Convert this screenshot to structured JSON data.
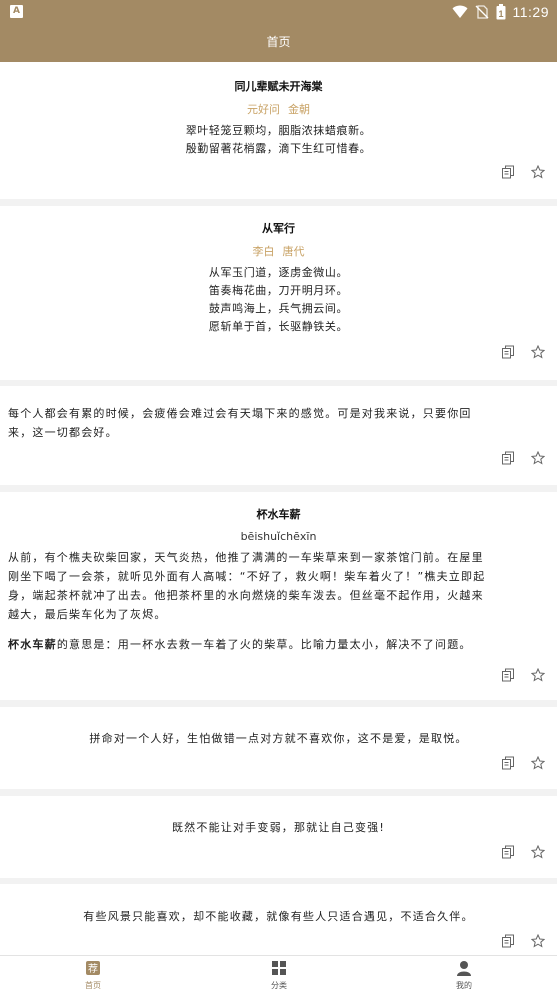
{
  "status": {
    "app_badge": "A",
    "time": "11:29",
    "battery_text": "1"
  },
  "header": {
    "title": "首页"
  },
  "cards": {
    "c1": {
      "title": "同儿辈赋未开海棠",
      "author": "元好问",
      "dynasty": "金朝",
      "lines": [
        "翠叶轻笼豆颗均，胭脂浓抹蜡痕新。",
        "殷勤留著花梢露，滴下生红可惜春。"
      ]
    },
    "c2": {
      "title": "从军行",
      "author": "李白",
      "dynasty": "唐代",
      "lines": [
        "从军玉门道，逐虏金微山。",
        "笛奏梅花曲，刀开明月环。",
        "鼓声鸣海上，兵气拥云间。",
        "愿斩单于首，长驱静铁关。"
      ]
    },
    "c3": {
      "line1": "每个人都会有累的时候，会疲倦会难过会有天塌下来的感觉。可是对我来说，只要你回",
      "line2": "来，这一切都会好。"
    },
    "c4": {
      "title": "杯水车薪",
      "pinyin": "bēishuǐchēxīn",
      "story": [
        "从前，有个樵夫砍柴回家，天气炎热，他推了满满的一车柴草来到一家茶馆门前。在屋里",
        "刚坐下喝了一会茶，就听见外面有人高喊：“不好了，救火啊！柴车着火了！”樵夫立即起",
        "身，端起茶杯就冲了出去。他把茶杯里的水向燃烧的柴车泼去。但丝毫不起作用，火越来",
        "越大，最后柴车化为了灰烬。"
      ],
      "meaning_term": "杯水车薪",
      "meaning_text": "的意思是：用一杯水去救一车着了火的柴草。比喻力量太小，解决不了问题。"
    },
    "c5": {
      "text": "拼命对一个人好，生怕做错一点对方就不喜欢你，这不是爱，是取悦。"
    },
    "c6": {
      "text": "既然不能让对手变弱，那就让自己变强!"
    },
    "c7": {
      "text": "有些风景只能喜欢，却不能收藏，就像有些人只适合遇见，不适合久伴。"
    }
  },
  "tabs": [
    {
      "label": "首页",
      "icon": "recommend-icon",
      "badge": "荐"
    },
    {
      "label": "分类",
      "icon": "grid-icon"
    },
    {
      "label": "我的",
      "icon": "person-icon"
    }
  ],
  "colors": {
    "brand": "#a38a64",
    "author": "#c8a265",
    "background": "#f2f2f2"
  }
}
